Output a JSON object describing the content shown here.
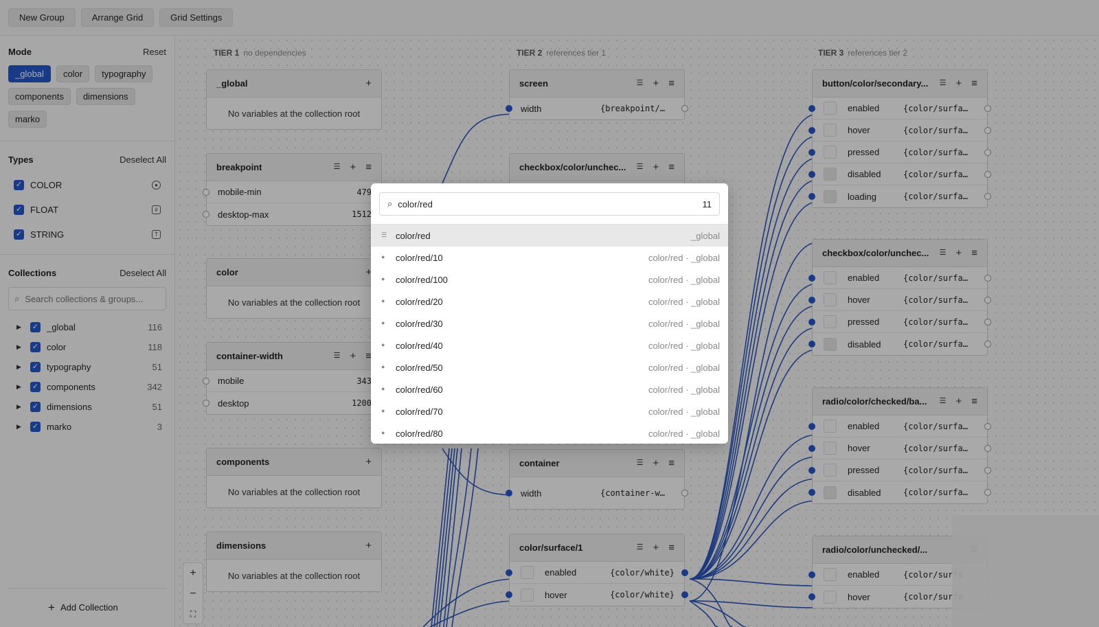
{
  "toolbar": {
    "new_group": "New Group",
    "arrange_grid": "Arrange Grid",
    "grid_settings": "Grid Settings"
  },
  "mode": {
    "title": "Mode",
    "reset": "Reset",
    "chips": [
      {
        "label": "_global",
        "active": true
      },
      {
        "label": "color",
        "active": false
      },
      {
        "label": "typography",
        "active": false
      },
      {
        "label": "components",
        "active": false
      },
      {
        "label": "dimensions",
        "active": false
      },
      {
        "label": "marko",
        "active": false
      }
    ]
  },
  "types": {
    "title": "Types",
    "deselect": "Deselect All",
    "items": [
      {
        "label": "COLOR",
        "icon": "palette-icon"
      },
      {
        "label": "FLOAT",
        "icon": "number-icon"
      },
      {
        "label": "STRING",
        "icon": "text-icon"
      }
    ]
  },
  "collections": {
    "title": "Collections",
    "deselect": "Deselect All",
    "search_placeholder": "Search collections & groups...",
    "items": [
      {
        "name": "_global",
        "count": "116"
      },
      {
        "name": "color",
        "count": "118"
      },
      {
        "name": "typography",
        "count": "51"
      },
      {
        "name": "components",
        "count": "342"
      },
      {
        "name": "dimensions",
        "count": "51"
      },
      {
        "name": "marko",
        "count": "3"
      }
    ],
    "add": "Add Collection"
  },
  "tiers": [
    {
      "label": "TIER 1",
      "desc": "no dependencies"
    },
    {
      "label": "TIER 2",
      "desc": "references tier 1"
    },
    {
      "label": "TIER 3",
      "desc": "references tier 2"
    }
  ],
  "nodes": {
    "empty_text": "No variables at the collection root",
    "global": {
      "title": "_global"
    },
    "breakpoint": {
      "title": "breakpoint",
      "rows": [
        {
          "name": "mobile-min",
          "value": "479"
        },
        {
          "name": "desktop-max",
          "value": "1512"
        }
      ]
    },
    "color": {
      "title": "color"
    },
    "container_width": {
      "title": "container-width",
      "rows": [
        {
          "name": "mobile",
          "value": "343"
        },
        {
          "name": "desktop",
          "value": "1200"
        }
      ]
    },
    "components": {
      "title": "components"
    },
    "dimensions": {
      "title": "dimensions"
    },
    "screen": {
      "title": "screen",
      "rows": [
        {
          "name": "width",
          "value": "{breakpoint/…"
        }
      ]
    },
    "checkbox_t2": {
      "title": "checkbox/color/unchec..."
    },
    "container": {
      "title": "container",
      "rows": [
        {
          "name": "width",
          "value": "{container-w…"
        }
      ]
    },
    "surface1": {
      "title": "color/surface/1",
      "rows": [
        {
          "name": "enabled",
          "value": "{color/white}"
        },
        {
          "name": "hover",
          "value": "{color/white}"
        }
      ]
    },
    "btn_secondary": {
      "title": "button/color/secondary...",
      "rows": [
        {
          "name": "enabled",
          "value": "{color/surfa…"
        },
        {
          "name": "hover",
          "value": "{color/surfa…"
        },
        {
          "name": "pressed",
          "value": "{color/surfa…"
        },
        {
          "name": "disabled",
          "value": "{color/surfa…"
        },
        {
          "name": "loading",
          "value": "{color/surfa…"
        }
      ]
    },
    "checkbox_t3": {
      "title": "checkbox/color/unchec...",
      "rows": [
        {
          "name": "enabled",
          "value": "{color/surfa…"
        },
        {
          "name": "hover",
          "value": "{color/surfa…"
        },
        {
          "name": "pressed",
          "value": "{color/surfa…"
        },
        {
          "name": "disabled",
          "value": "{color/surfa…"
        }
      ]
    },
    "radio_checked": {
      "title": "radio/color/checked/ba...",
      "rows": [
        {
          "name": "enabled",
          "value": "{color/surfa…"
        },
        {
          "name": "hover",
          "value": "{color/surfa…"
        },
        {
          "name": "pressed",
          "value": "{color/surfa…"
        },
        {
          "name": "disabled",
          "value": "{color/surfa…"
        }
      ]
    },
    "radio_unchecked": {
      "title": "radio/color/unchecked/...",
      "rows": [
        {
          "name": "enabled",
          "value": "{color/surfa"
        },
        {
          "name": "hover",
          "value": "{color/surfa"
        }
      ]
    }
  },
  "palette": {
    "query": "color/red",
    "count": "11",
    "items": [
      {
        "name": "color/red",
        "path": "_global",
        "selected": true,
        "kind": "group"
      },
      {
        "name": "color/red/10",
        "path": "color/red · _global"
      },
      {
        "name": "color/red/100",
        "path": "color/red · _global"
      },
      {
        "name": "color/red/20",
        "path": "color/red · _global"
      },
      {
        "name": "color/red/30",
        "path": "color/red · _global"
      },
      {
        "name": "color/red/40",
        "path": "color/red · _global"
      },
      {
        "name": "color/red/50",
        "path": "color/red · _global"
      },
      {
        "name": "color/red/60",
        "path": "color/red · _global"
      },
      {
        "name": "color/red/70",
        "path": "color/red · _global"
      },
      {
        "name": "color/red/80",
        "path": "color/red · _global"
      }
    ]
  },
  "colors": {
    "accent": "#2557c7",
    "wire": "#2a55b8"
  }
}
